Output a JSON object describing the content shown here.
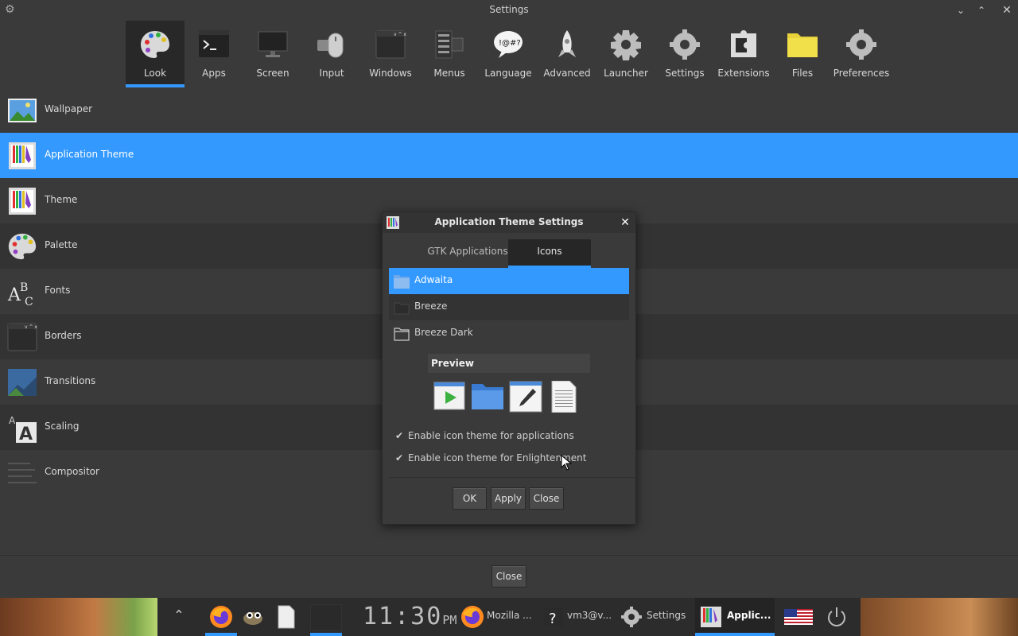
{
  "window": {
    "title": "Settings",
    "controls": [
      "minimize",
      "maximize",
      "close"
    ]
  },
  "categories": [
    {
      "label": "Look",
      "icon": "palette-icon",
      "selected": true
    },
    {
      "label": "Apps",
      "icon": "terminal-icon"
    },
    {
      "label": "Screen",
      "icon": "monitor-icon"
    },
    {
      "label": "Input",
      "icon": "mouse-keyboard-icon"
    },
    {
      "label": "Windows",
      "icon": "window-icon"
    },
    {
      "label": "Menus",
      "icon": "menu-icon"
    },
    {
      "label": "Language",
      "icon": "speech-bubble-icon"
    },
    {
      "label": "Advanced",
      "icon": "rocket-icon"
    },
    {
      "label": "Launcher",
      "icon": "cog-icon"
    },
    {
      "label": "Settings",
      "icon": "gear-icon"
    },
    {
      "label": "Extensions",
      "icon": "puzzle-icon"
    },
    {
      "label": "Files",
      "icon": "folder-icon"
    },
    {
      "label": "Preferences",
      "icon": "gear-icon"
    }
  ],
  "look_items": [
    {
      "label": "Wallpaper",
      "icon": "wallpaper-icon"
    },
    {
      "label": "Application Theme",
      "icon": "theme-icon",
      "selected": true
    },
    {
      "label": "Theme",
      "icon": "theme-icon"
    },
    {
      "label": "Palette",
      "icon": "palette-icon"
    },
    {
      "label": "Fonts",
      "icon": "fonts-icon"
    },
    {
      "label": "Borders",
      "icon": "borders-icon"
    },
    {
      "label": "Transitions",
      "icon": "transitions-icon"
    },
    {
      "label": "Scaling",
      "icon": "scaling-icon"
    },
    {
      "label": "Compositor",
      "icon": "compositor-icon"
    }
  ],
  "main": {
    "close_label": "Close"
  },
  "dialog": {
    "title": "Application Theme Settings",
    "tabs": [
      {
        "label": "GTK Applications"
      },
      {
        "label": "Icons",
        "selected": true
      }
    ],
    "icon_themes": [
      {
        "label": "Adwaita",
        "selected": true
      },
      {
        "label": "Breeze"
      },
      {
        "label": "Breeze Dark"
      }
    ],
    "preview_label": "Preview",
    "options": [
      {
        "label": "Enable icon theme for applications",
        "checked": true
      },
      {
        "label": "Enable icon theme for Enlightenment",
        "checked": true
      }
    ],
    "buttons": {
      "ok": "OK",
      "apply": "Apply",
      "close": "Close"
    }
  },
  "taskbar": {
    "clock": {
      "time": "11:30",
      "ampm": "PM"
    },
    "tasks": [
      {
        "label": "Mozilla ...",
        "icon": "firefox-icon"
      },
      {
        "label": "vm3@v...",
        "icon": "terminal-question-icon"
      },
      {
        "label": "Settings",
        "icon": "gear-icon"
      },
      {
        "label": "Applic...",
        "icon": "theme-icon",
        "active": true
      }
    ],
    "colors": {
      "accent": "#3399ff"
    }
  }
}
